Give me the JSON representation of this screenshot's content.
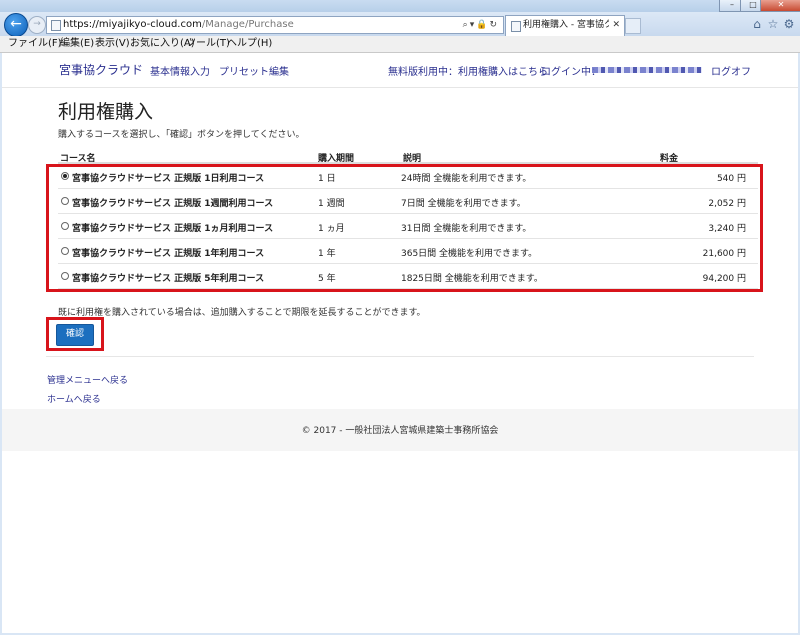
{
  "browser": {
    "url_host": "https://miyajikyo-cloud.com",
    "url_path": "/Manage/Purchase",
    "tab_title": "利用権購入 - 宮事協クラウ...",
    "menu": [
      "ファイル(F)",
      "編集(E)",
      "表示(V)",
      "お気に入り(A)",
      "ツール(T)",
      "ヘルプ(H)"
    ]
  },
  "header": {
    "brand": "宮事協クラウド",
    "nav": [
      "基本情報入力",
      "プリセット編集"
    ],
    "trial_notice": "無料版利用中：利用権購入はこちら",
    "login_label": "ログイン中：",
    "logout": "ログオフ"
  },
  "page": {
    "title": "利用権購入",
    "instruction": "購入するコースを選択し、「確認」ボタンを押してください。",
    "columns": {
      "name": "コース名",
      "period": "購入期間",
      "desc": "説明",
      "price": "料金"
    },
    "courses": [
      {
        "name": "宮事協クラウドサービス 正規版 1日利用コース",
        "period": "1 日",
        "desc": "24時間 全機能を利用できます。",
        "price": "540 円",
        "selected": true
      },
      {
        "name": "宮事協クラウドサービス 正規版 1週間利用コース",
        "period": "1 週間",
        "desc": "7日間 全機能を利用できます。",
        "price": "2,052 円",
        "selected": false
      },
      {
        "name": "宮事協クラウドサービス 正規版 1ヵ月利用コース",
        "period": "1 ヵ月",
        "desc": "31日間 全機能を利用できます。",
        "price": "3,240 円",
        "selected": false
      },
      {
        "name": "宮事協クラウドサービス 正規版 1年利用コース",
        "period": "1 年",
        "desc": "365日間 全機能を利用できます。",
        "price": "21,600 円",
        "selected": false
      },
      {
        "name": "宮事協クラウドサービス 正規版 5年利用コース",
        "period": "5 年",
        "desc": "1825日間 全機能を利用できます。",
        "price": "94,200 円",
        "selected": false
      }
    ],
    "note": "既に利用権を購入されている場合は、追加購入することで期限を延長することができます。",
    "confirm_label": "確認",
    "links": [
      "管理メニューへ戻る",
      "ホームへ戻る"
    ]
  },
  "footer": {
    "copyright": "© 2017 - 一般社団法人宮城県建築士事務所協会"
  },
  "colors": {
    "brand": "#2a2f8f",
    "button": "#1c6fbf",
    "highlight": "#d8141b"
  }
}
